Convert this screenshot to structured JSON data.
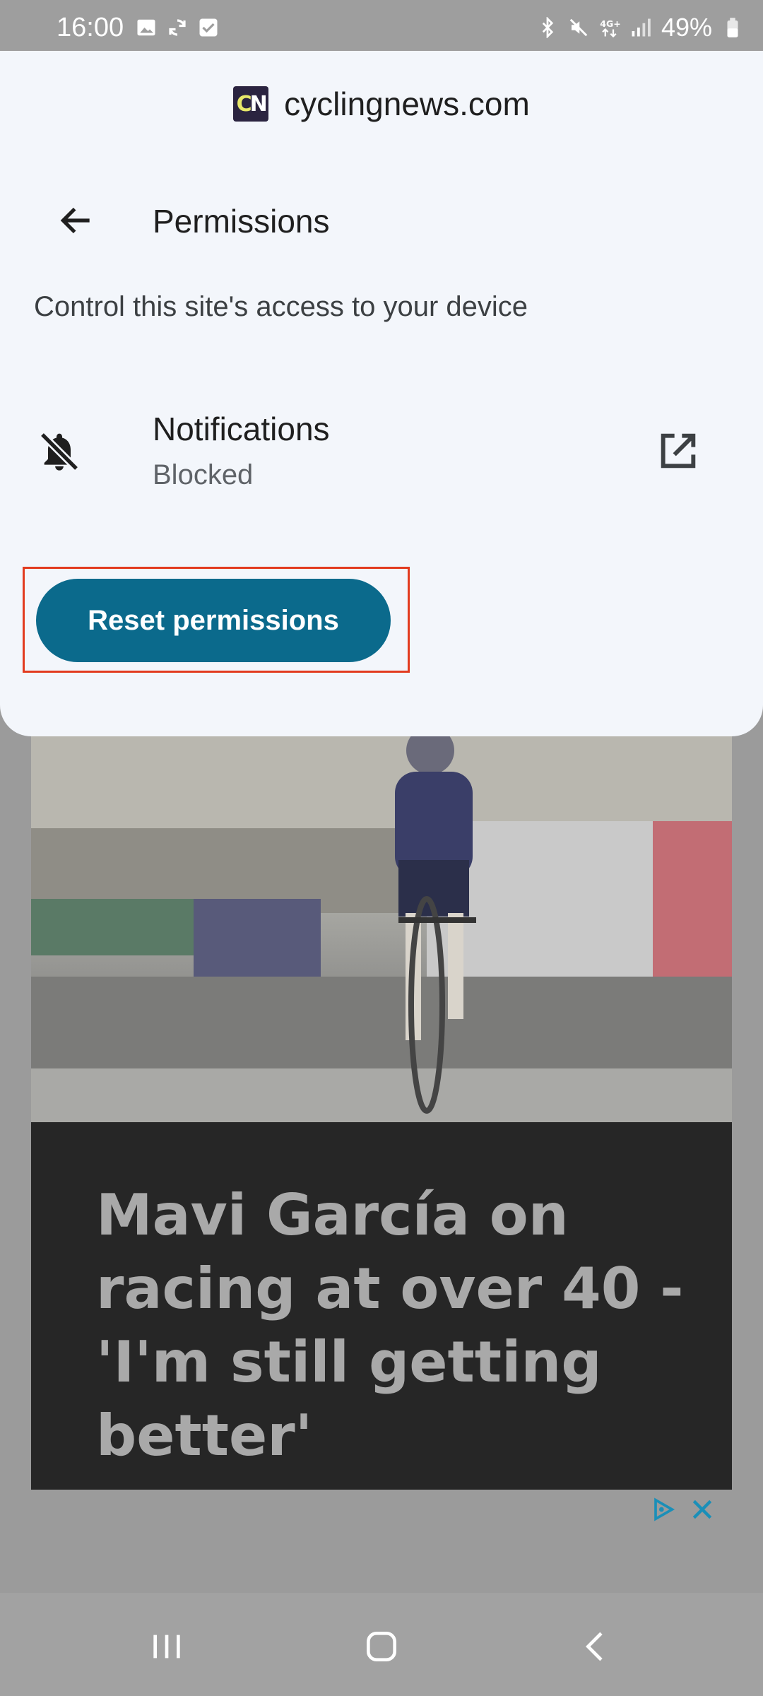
{
  "status_bar": {
    "time": "16:00",
    "battery": "49%",
    "left_icons": [
      "image-icon",
      "sync-icon",
      "check-box-icon"
    ],
    "right_icons": [
      "bluetooth-icon",
      "mute-icon",
      "4g-icon",
      "signal-icon",
      "battery-icon"
    ]
  },
  "sheet": {
    "site_logo": "CN",
    "site_name": "cyclingnews.com",
    "title": "Permissions",
    "subtitle": "Control this site's access to your device",
    "notifications": {
      "label": "Notifications",
      "state": "Blocked"
    },
    "reset_button": "Reset permissions"
  },
  "article": {
    "headline": "Mavi García on racing at over 40 - 'I'm still getting better'"
  },
  "colors": {
    "accent_button": "#0b6a8c",
    "highlight_box": "#e23b1f",
    "sheet_bg": "#f3f6fb"
  }
}
